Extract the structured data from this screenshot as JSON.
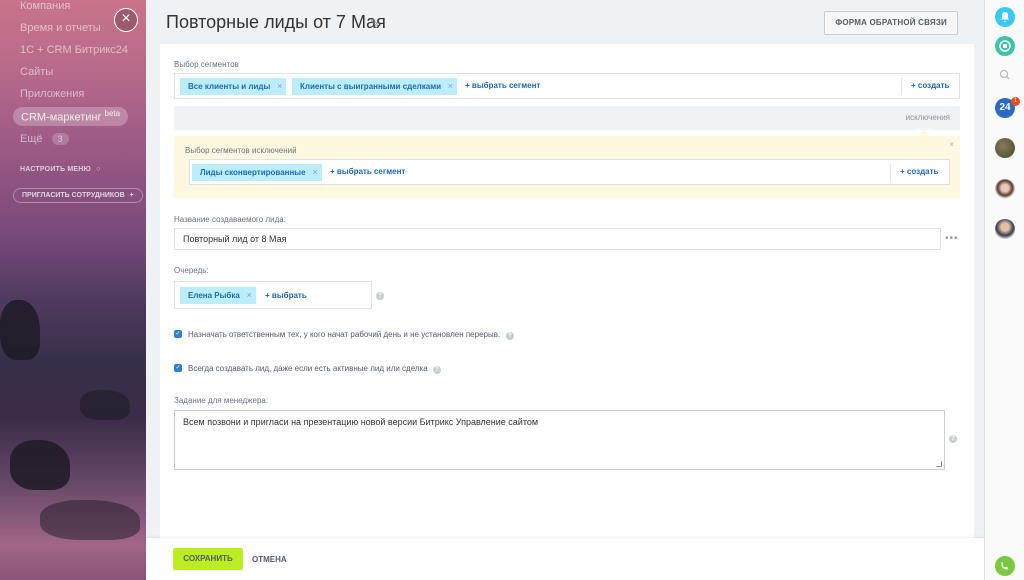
{
  "sidebar": {
    "items": [
      {
        "label": "Компания"
      },
      {
        "label": "Время и отчеты"
      },
      {
        "label": "1С + CRM Битрикс24"
      },
      {
        "label": "Сайты"
      },
      {
        "label": "Приложения"
      }
    ],
    "active_label": "CRM-маркетинг",
    "active_sup": "beta",
    "more_label": "Ещё",
    "more_count": "3",
    "configure_menu": "НАСТРОИТЬ МЕНЮ",
    "invite_label": "ПРИГЛАСИТЬ СОТРУДНИКОВ"
  },
  "header": {
    "title": "Повторные лиды от 7 Мая",
    "feedback_label": "ФОРМА ОБРАТНОЙ СВЯЗИ"
  },
  "segments": {
    "label": "Выбор сегментов",
    "tags": [
      "Все клиенты и лиды",
      "Клиенты с выигранными сделками"
    ],
    "select_label": "+ выбрать сегмент",
    "create_label": "+ создать"
  },
  "exclusions": {
    "tab_label": "исключения",
    "label": "Выбор сегментов исключений",
    "tags": [
      "Лиды сконвертированные"
    ],
    "select_label": "+ выбрать сегмент",
    "create_label": "+ создать"
  },
  "lead_name": {
    "label": "Название создаваемого лида:",
    "value": "Повторный лид от 8 Мая"
  },
  "queue": {
    "label": "Очередь:",
    "tags": [
      "Елена Рыбка"
    ],
    "select_label": "+ выбрать"
  },
  "options": [
    {
      "label": "Назначать ответственным тех, у кого начат рабочий день и не установлен перерыв.",
      "checked": true
    },
    {
      "label": "Всегда создавать лид, даже если есть активные лид или сделка",
      "checked": true
    }
  ],
  "task": {
    "label": "Задание для менеджера:",
    "value": "Всем позвони и пригласи на презентацию новой версии Битрикс Управление сайтом"
  },
  "footer": {
    "save_label": "СОХРАНИТЬ",
    "cancel_label": "ОТМЕНА"
  },
  "rightbar": {
    "b24_label": "24",
    "b24_badge": "1"
  },
  "colors": {
    "accent_save": "#bbed21",
    "tag_bg": "#bcedfc",
    "link": "#2067b0",
    "exclusion_bg": "#fef8e0"
  }
}
